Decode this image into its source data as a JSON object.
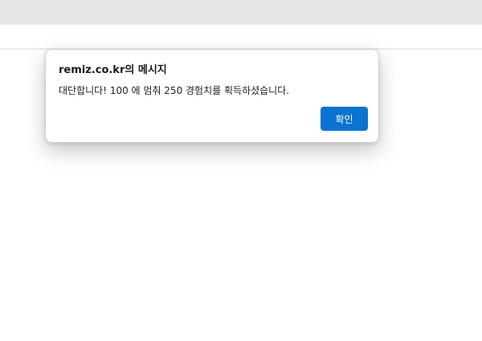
{
  "dialog": {
    "title": "remiz.co.kr의 메시지",
    "message": "대단합니다! 100 에 멈춰 250 경험치를 획득하셨습니다.",
    "ok_label": "확인"
  },
  "colors": {
    "accent": "#0b73d1",
    "tabstrip": "#e6e6e6"
  }
}
